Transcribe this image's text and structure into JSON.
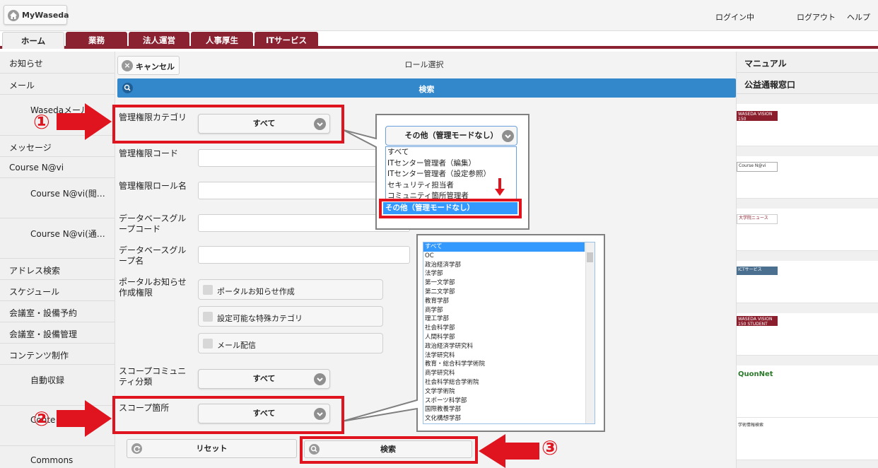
{
  "header": {
    "home_label": "MyWaseda",
    "login_status": "ログイン中",
    "logout": "ログアウト",
    "help": "ヘルプ"
  },
  "tabs": [
    {
      "label": "ホーム"
    },
    {
      "label": "業務"
    },
    {
      "label": "法人運営"
    },
    {
      "label": "人事厚生"
    },
    {
      "label": "ITサービス"
    }
  ],
  "sidebar": {
    "items": [
      {
        "label": "お知らせ"
      },
      {
        "label": "メール"
      },
      {
        "label": "Wasedaメール"
      },
      {
        "label": "メッセージ"
      },
      {
        "label": "Course N@vi"
      },
      {
        "label": "Course N@vi(閲…"
      },
      {
        "label": "Course N@vi(通…"
      },
      {
        "label": "アドレス検索"
      },
      {
        "label": "スケジュール"
      },
      {
        "label": "会議室・設備予約"
      },
      {
        "label": "会議室・設備管理"
      },
      {
        "label": "コンテンツ制作"
      },
      {
        "label": "自動収録"
      },
      {
        "label": "Conte"
      },
      {
        "label": "Commons"
      }
    ]
  },
  "rightbar": {
    "items": [
      {
        "label": "マニュアル"
      },
      {
        "label": "公益通報窓口"
      }
    ],
    "banners": [
      {
        "label": "WASEDA VISION 150"
      },
      {
        "label": "Course N@vi"
      },
      {
        "label": "大学院ニュース"
      },
      {
        "label": "ICTサービス"
      },
      {
        "label": "WASEDA VISION 150 STUDENT COMPETITION"
      },
      {
        "label": "QuonNet"
      },
      {
        "label": "学術情報検索"
      }
    ]
  },
  "main": {
    "cancel_label": "キャンセル",
    "role_title": "ロール選択",
    "search_bar_label": "検索",
    "fields": {
      "category_label": "管理権限カテゴリ",
      "category_value": "すべて",
      "code_label": "管理権限コード",
      "role_name_label": "管理権限ロール名",
      "db_group_code_label": "データベースグループコード",
      "db_group_name_label": "データベースグループ名",
      "portal_label": "ポータルお知らせ作成権限",
      "check_portal": "ポータルお知らせ作成",
      "check_special": "設定可能な特殊カテゴリ",
      "check_mail": "メール配信",
      "scope_community_label": "スコープコミュニティ分類",
      "scope_community_value": "すべて",
      "scope_place_label": "スコープ箇所",
      "scope_place_value": "すべて"
    },
    "reset_label": "リセット",
    "search_label": "検索"
  },
  "annotations": {
    "badge1": "①",
    "badge2": "②",
    "badge3": "③"
  },
  "dropdown1": {
    "selected": "その他（管理モードなし）",
    "options": [
      "すべて",
      "ITセンター管理者（編集）",
      "ITセンター管理者（設定参照）",
      "セキュリティ担当者",
      "コミュニティ箇所管理者"
    ],
    "highlighted": "その他（管理モードなし）"
  },
  "dropdown2": {
    "options": [
      "すべて",
      "OC",
      "政治経済学部",
      "法学部",
      "第一文学部",
      "第二文学部",
      "教育学部",
      "商学部",
      "理工学部",
      "社会科学部",
      "人間科学部",
      "政治経済学研究科",
      "法学研究科",
      "教育・総合科学学術院",
      "商学研究科",
      "社会科学総合学術院",
      "文学学術院",
      "スポーツ科学部",
      "国際教養学部",
      "文化構想学部"
    ]
  },
  "colors": {
    "tab_bg": "#8b2232",
    "search_bar": "#3388cc",
    "annotation_red": "#e0141e",
    "highlight_blue": "#3399ff"
  }
}
